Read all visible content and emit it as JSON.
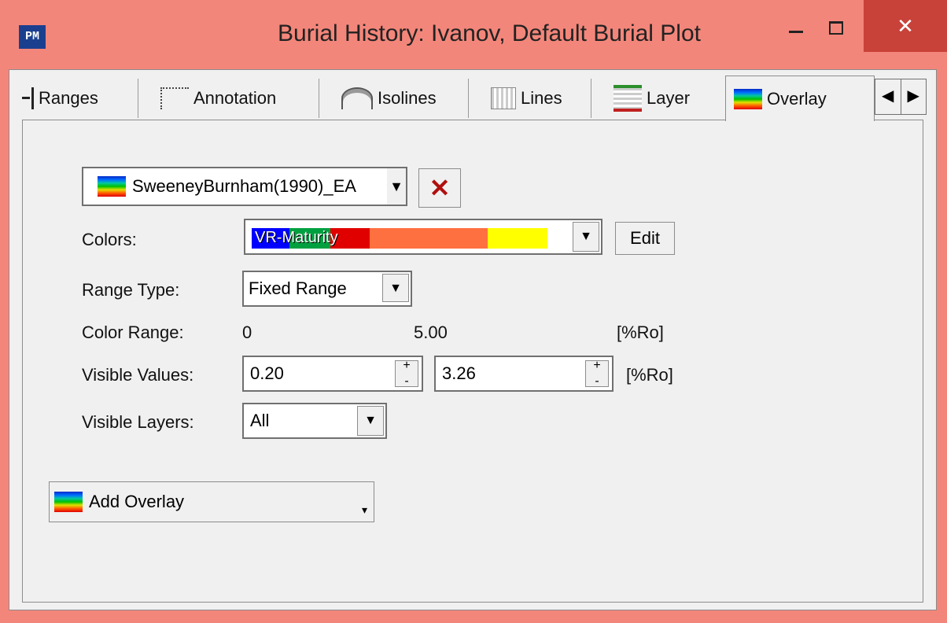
{
  "window": {
    "app_icon_text": "PM",
    "title": "Burial History: Ivanov,  Default Burial Plot",
    "close_glyph": "✕"
  },
  "tabs": [
    {
      "label": "Ranges",
      "icon": "ranges-icon"
    },
    {
      "label": "Annotation",
      "icon": "annotation-icon"
    },
    {
      "label": "Isolines",
      "icon": "isolines-icon"
    },
    {
      "label": "Lines",
      "icon": "lines-icon"
    },
    {
      "label": "Layer",
      "icon": "layer-icon"
    },
    {
      "label": "Overlay",
      "icon": "overlay-icon",
      "active": true
    }
  ],
  "tab_scroll": {
    "left": "◀",
    "right": "▶"
  },
  "overlay": {
    "selected": "SweeneyBurnham(1990)_EA",
    "delete_glyph": "✕"
  },
  "colors": {
    "label": "Colors:",
    "scheme": "VR-Maturity",
    "edit_label": "Edit",
    "bands": [
      "#0000ff",
      "#00a040",
      "#e00000",
      "#ff7040",
      "#ff7040",
      "#ffff00",
      "#ffffff"
    ]
  },
  "range_type": {
    "label": "Range Type:",
    "value": "Fixed Range"
  },
  "color_range": {
    "label": "Color Range:",
    "min": "0",
    "max": "5.00",
    "unit": "[%Ro]"
  },
  "visible_values": {
    "label": "Visible Values:",
    "min": "0.20",
    "max": "3.26",
    "unit": "[%Ro]"
  },
  "visible_layers": {
    "label": "Visible Layers:",
    "value": "All"
  },
  "add_overlay": {
    "label": "Add Overlay"
  }
}
